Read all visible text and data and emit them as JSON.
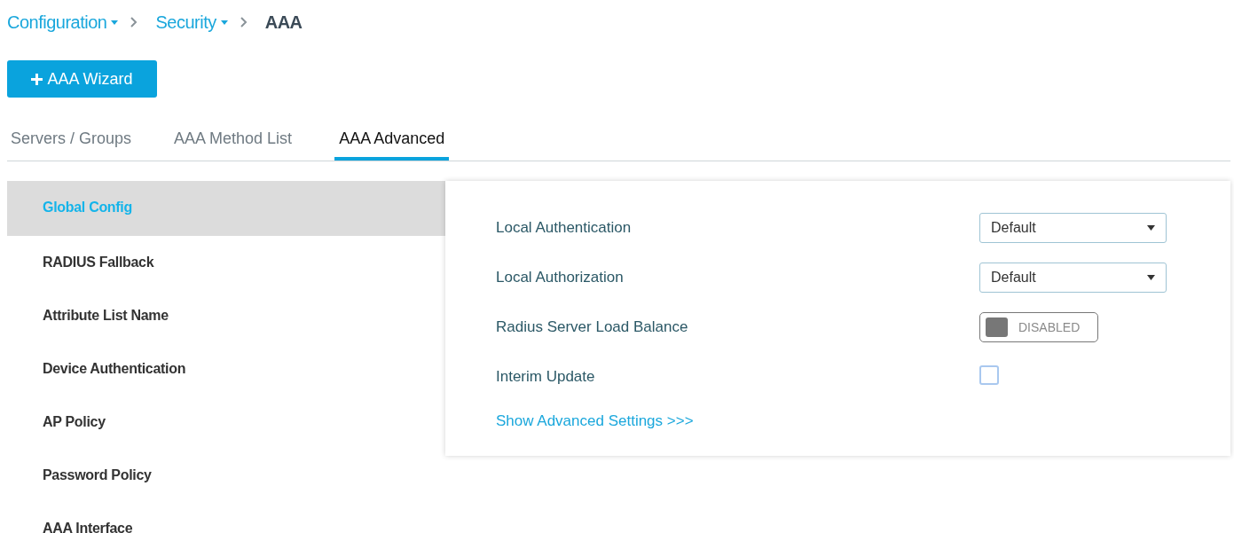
{
  "breadcrumb": [
    {
      "label": "Configuration",
      "dropdown": true
    },
    {
      "label": "Security",
      "dropdown": true
    },
    {
      "label": "AAA",
      "dropdown": false
    }
  ],
  "wizard_button": {
    "label": "AAA Wizard"
  },
  "tabs": [
    {
      "label": "Servers / Groups",
      "selected": false
    },
    {
      "label": "AAA Method List",
      "selected": false
    },
    {
      "label": "AAA Advanced",
      "selected": true
    }
  ],
  "sidebar": {
    "items": [
      {
        "label": "Global Config",
        "selected": true
      },
      {
        "label": "RADIUS Fallback",
        "selected": false
      },
      {
        "label": "Attribute List Name",
        "selected": false
      },
      {
        "label": "Device Authentication",
        "selected": false
      },
      {
        "label": "AP Policy",
        "selected": false
      },
      {
        "label": "Password Policy",
        "selected": false
      },
      {
        "label": "AAA Interface",
        "selected": false
      }
    ]
  },
  "settings": [
    {
      "kind": "select",
      "label": "Local Authentication",
      "value": "Default"
    },
    {
      "kind": "select",
      "label": "Local Authorization",
      "value": "Default"
    },
    {
      "kind": "toggle",
      "label": "Radius Server Load Balance",
      "on": false,
      "text": "DISABLED"
    },
    {
      "kind": "checkbox",
      "label": "Interim Update",
      "checked": false
    }
  ],
  "advanced_link": "Show Advanced Settings >>>"
}
